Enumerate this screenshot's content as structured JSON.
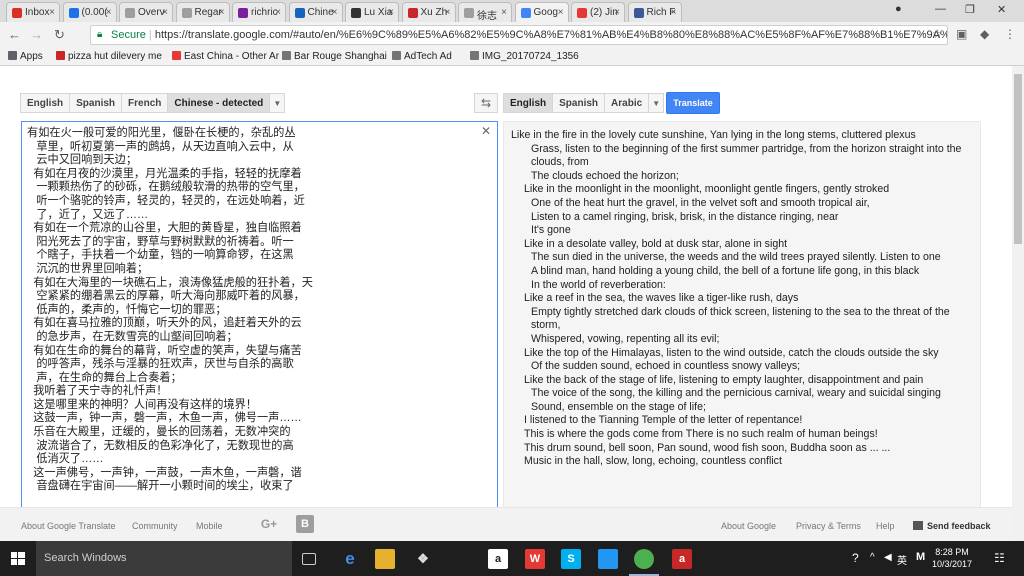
{
  "browser": {
    "tabs": [
      {
        "label": "Inbox",
        "favicon": "gmail-icon",
        "color": "#d93025"
      },
      {
        "label": "(0.00(",
        "favicon": "blue-b-icon",
        "color": "#1a73e8"
      },
      {
        "label": "Overv",
        "favicon": "page-icon",
        "color": "#9e9e9e"
      },
      {
        "label": "Regar",
        "favicon": "page-icon",
        "color": "#9e9e9e"
      },
      {
        "label": "richric",
        "favicon": "mail-icon",
        "color": "#7b1fa2"
      },
      {
        "label": "Chine",
        "favicon": "blue-swoosh-icon",
        "color": "#1565c0"
      },
      {
        "label": "Lu Xia",
        "favicon": "wikipedia-icon",
        "color": "#333333"
      },
      {
        "label": "Xu Zh",
        "favicon": "red-icon",
        "color": "#c62828"
      },
      {
        "label": "徐志",
        "favicon": "page-icon",
        "color": "#9e9e9e"
      },
      {
        "label": "Goog",
        "favicon": "google-translate-icon",
        "color": "#4285f4",
        "active": true
      },
      {
        "label": "(2) Jin",
        "favicon": "youtube-icon",
        "color": "#e53935"
      },
      {
        "label": "Rich F",
        "favicon": "facebook-icon",
        "color": "#3b5998"
      }
    ],
    "address": {
      "secure_label": "Secure",
      "url": "https://translate.google.com/#auto/en/%E6%9C%89%E5%A6%82%E5%9C%A8%E7%81%AB%E4%B8%80%E8%88%AC%E5%8F%AF%E7%88%B1%E7%9A%84%E9%98%B..."
    },
    "bookmarks": [
      {
        "label": "Apps",
        "icon": "apps-grid-icon",
        "color": "#5f6368"
      },
      {
        "label": "pizza hut dilevery me",
        "icon": "pizza-icon",
        "color": "#c62828"
      },
      {
        "label": "East China - Other Ar",
        "icon": "bookmark-icon",
        "color": "#e53935"
      },
      {
        "label": "Bar Rouge Shanghai",
        "icon": "page-icon",
        "color": "#757575"
      },
      {
        "label": "AdTech Ad",
        "icon": "page-icon",
        "color": "#757575"
      },
      {
        "label": "IMG_20170724_1356",
        "icon": "image-icon",
        "color": "#757575"
      }
    ]
  },
  "translate": {
    "source_langs": [
      "English",
      "Spanish",
      "French",
      "Chinese - detected"
    ],
    "target_langs": [
      "English",
      "Spanish",
      "Arabic"
    ],
    "translate_label": "Translate",
    "source_lines": [
      "有如在火一般可爱的阳光里，偃卧在长梗的，杂乱的丛",
      "   草里，听初夏第一声的鹧鸪，从天边直响入云中，从",
      "   云中又回响到天边；",
      "  有如在月夜的沙漠里，月光温柔的手指，轻轻的抚摩着",
      "   一颗颗热伤了的砂砾，在鹅绒般软滑的热带的空气里，",
      "   听一个骆驼的铃声，轻灵的，轻灵的，在远处响着，近",
      "   了，近了，又远了……",
      "  有如在一个荒凉的山谷里，大胆的黄昏星，独自临照着",
      "   阳光死去了的宇宙，野草与野树默默的祈祷着。听一",
      "   个瞎子，手扶着一个幼童，铛的一响算命锣，在这黑",
      "   沉沉的世界里回响着；",
      "  有如在大海里的一块礁石上，浪涛像猛虎般的狂扑着，天",
      "   空紧紧的绷着黑云的厚幕，听大海向那威吓着的风暴，",
      "   低声的，柔声的，忏悔它一切的罪恶；",
      "  有如在喜马拉雅的顶巅，听天外的风，追赶着天外的云",
      "   的急步声，在无数雪亮的山壑间回响着；",
      "  有如在生命的舞台的幕背，听空虚的笑声，失望与痛苦",
      "   的呼答声，残杀与淫暴的狂欢声，厌世与自杀的高歌",
      "   声，在生命的舞台上合奏着；",
      "  我听着了天宁寺的礼忏声！",
      "  这是哪里来的神明？人间再没有这样的境界！",
      "  这鼓一声，钟一声，磬一声，木鱼一声，佛号一声……",
      "  乐音在大殿里，迂缓的，曼长的回荡着，无数冲突的",
      "   波流谐合了，无数相反的色彩净化了，无数现世的高",
      "   低消灭了……",
      "  这一声佛号，一声钟，一声鼓，一声木鱼，一声磬，谐",
      "   音盘礴在宇宙间——解开一小颗时间的埃尘，收束了"
    ],
    "target_lines": [
      {
        "text": "Like in the fire in the lovely cute sunshine, Yan lying in the long stems, cluttered plexus",
        "indent": 0
      },
      {
        "text": "Grass, listen to the beginning of the first summer partridge, from the horizon straight into the clouds, from",
        "indent": 1
      },
      {
        "text": "The clouds echoed the horizon;",
        "indent": 1
      },
      {
        "text": "Like in the moonlight in the moonlight, moonlight gentle fingers, gently stroked",
        "indent": 2
      },
      {
        "text": "One of the heat hurt the gravel, in the velvet soft and smooth tropical air,",
        "indent": 1
      },
      {
        "text": "Listen to a camel ringing, brisk, brisk, in the distance ringing, near",
        "indent": 1
      },
      {
        "text": "It's gone",
        "indent": 1
      },
      {
        "text": "Like in a desolate valley, bold at dusk star, alone in sight",
        "indent": 2
      },
      {
        "text": "The sun died in the universe, the weeds and the wild trees prayed silently. Listen to one",
        "indent": 1
      },
      {
        "text": "A blind man, hand holding a young child, the bell of a fortune life gong, in this black",
        "indent": 1
      },
      {
        "text": "In the world of reverberation:",
        "indent": 1
      },
      {
        "text": "Like a reef in the sea, the waves like a tiger-like rush, days",
        "indent": 2
      },
      {
        "text": "Empty tightly stretched dark clouds of thick screen, listening to the sea to the threat of the storm,",
        "indent": 1
      },
      {
        "text": "Whispered, vowing, repenting all its evil;",
        "indent": 1
      },
      {
        "text": "Like the top of the Himalayas, listen to the wind outside, catch the clouds outside the sky",
        "indent": 2
      },
      {
        "text": "Of the sudden sound, echoed in countless snowy valleys;",
        "indent": 1
      },
      {
        "text": "Like the back of the stage of life, listening to empty laughter, disappointment and pain",
        "indent": 2
      },
      {
        "text": "The voice of the song, the killing and the pernicious carnival, weary and suicidal singing",
        "indent": 1
      },
      {
        "text": "Sound, ensemble on the stage of life;",
        "indent": 1
      },
      {
        "text": "I listened to the Tianning Temple of the letter of repentance!",
        "indent": 2
      },
      {
        "text": "This is where the gods come from There is no such realm of human beings!",
        "indent": 2
      },
      {
        "text": "This drum sound, bell soon, Pan sound, wood fish soon, Buddha soon as ... ...",
        "indent": 2
      },
      {
        "text": "Music in the hall, slow, long, echoing, countless conflict",
        "indent": 2
      }
    ]
  },
  "footer": {
    "about_translate": "About Google Translate",
    "community": "Community",
    "mobile": "Mobile",
    "about_google": "About Google",
    "privacy": "Privacy & Terms",
    "help": "Help",
    "feedback": "Send feedback"
  },
  "taskbar": {
    "search_placeholder": "Search Windows",
    "ime": "英",
    "time": "8:28 PM",
    "date": "10/3/2017"
  }
}
